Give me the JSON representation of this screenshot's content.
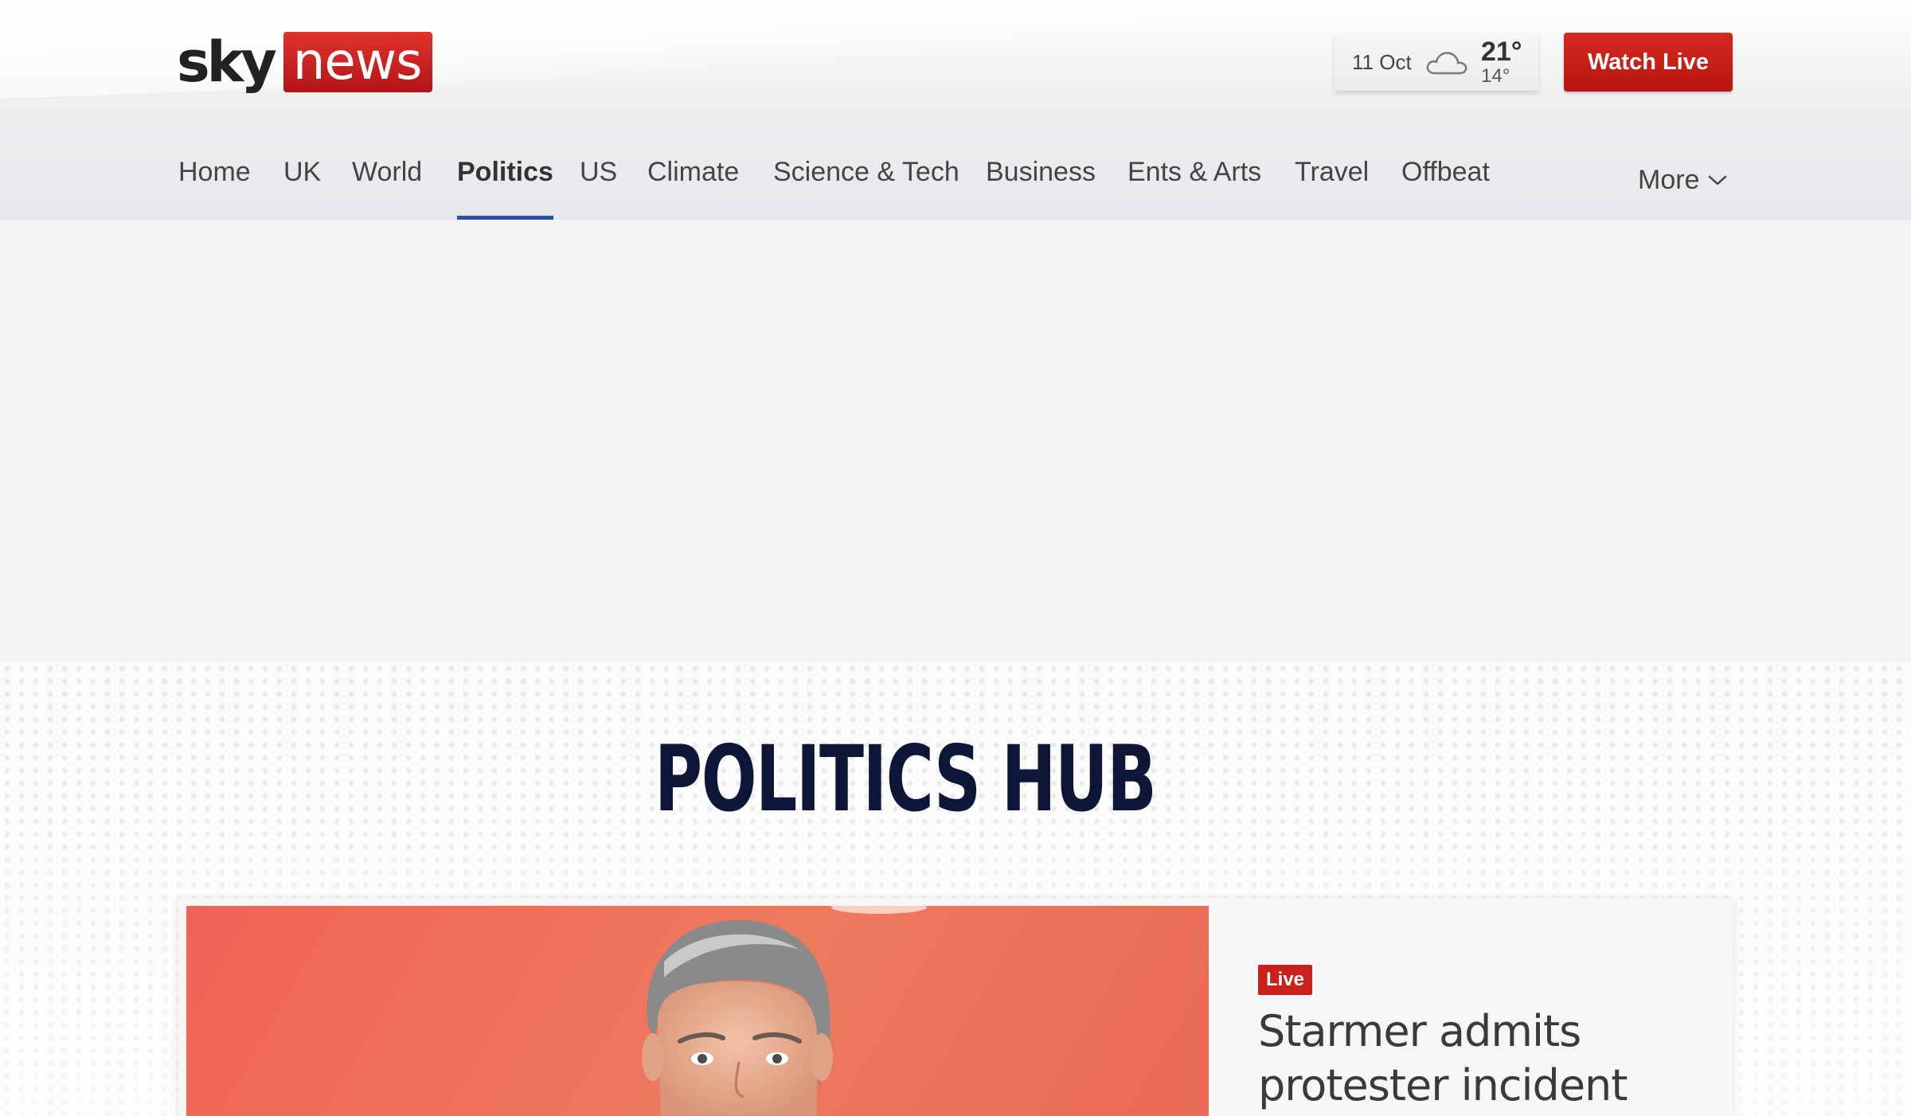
{
  "header": {
    "logo": {
      "sky": "sky",
      "news": "news"
    },
    "weather": {
      "date": "11 Oct",
      "high": "21°",
      "low": "14°",
      "icon": "cloud-icon"
    },
    "watch_live_label": "Watch Live"
  },
  "nav": {
    "items": [
      {
        "label": "Home"
      },
      {
        "label": "UK"
      },
      {
        "label": "World"
      },
      {
        "label": "Politics",
        "active": true
      },
      {
        "label": "US"
      },
      {
        "label": "Climate"
      },
      {
        "label": "Science & Tech"
      },
      {
        "label": "Business"
      },
      {
        "label": "Ents & Arts"
      },
      {
        "label": "Travel"
      },
      {
        "label": "Offbeat"
      }
    ],
    "more_label": "More"
  },
  "hub": {
    "title": "POLITICS HUB",
    "colors": [
      "#d23b2f",
      "#f0a93a",
      "#3aa8d4",
      "#2e6cc8",
      "#f3d43a",
      "#3a9b48"
    ]
  },
  "feature": {
    "badge": "Live",
    "headline": "Starmer admits protester incident"
  },
  "colors": {
    "brand_red": "#c8201b",
    "nav_active_underline": "#2c52a8",
    "hub_navy": "#0e1638"
  }
}
